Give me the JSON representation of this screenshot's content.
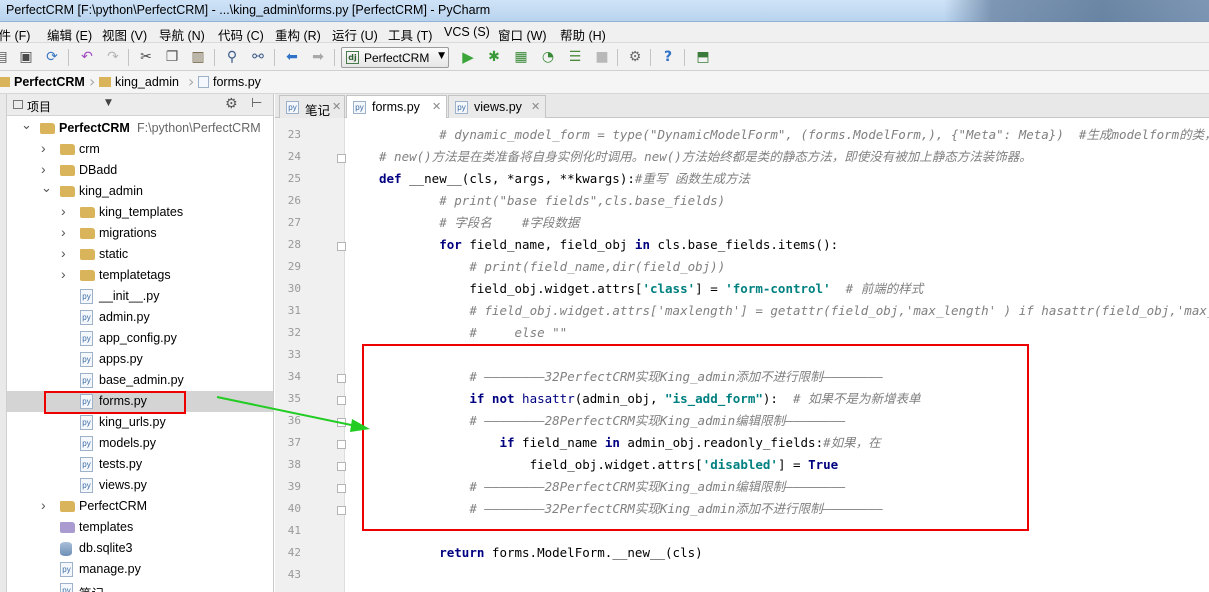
{
  "window": {
    "title": "PerfectCRM [F:\\python\\PerfectCRM] - ...\\king_admin\\forms.py [PerfectCRM] - PyCharm"
  },
  "menu": [
    "文件 (F)",
    "编辑 (E)",
    "视图 (V)",
    "导航 (N)",
    "代码 (C)",
    "重构 (R)",
    "运行 (U)",
    "工具 (T)",
    "VCS (S)",
    "窗口 (W)",
    "帮助 (H)"
  ],
  "toolbar": {
    "run_config": "PerfectCRM",
    "icons": [
      "save-icon",
      "sync-icon",
      "undo-icon",
      "redo-icon",
      "cut-icon",
      "copy-icon",
      "paste-icon",
      "find-icon",
      "replace-icon",
      "back-icon",
      "forward-icon",
      "run-icon",
      "debug-icon",
      "coverage-icon",
      "profile-icon",
      "concurrency-icon",
      "stop-icon",
      "settings-icon",
      "help-icon",
      "vcs-icon"
    ]
  },
  "breadcrumb": [
    "PerfectCRM",
    "king_admin",
    "forms.py"
  ],
  "project_panel": {
    "title": "项目",
    "tree": [
      {
        "label": "PerfectCRM",
        "sub": "F:\\python\\PerfectCRM",
        "type": "folder",
        "depth": 0,
        "expanded": true
      },
      {
        "label": "crm",
        "type": "folder",
        "depth": 1,
        "expanded": false
      },
      {
        "label": "DBadd",
        "type": "folder",
        "depth": 1,
        "expanded": false
      },
      {
        "label": "king_admin",
        "type": "folder",
        "depth": 1,
        "expanded": true
      },
      {
        "label": "king_templates",
        "type": "folder",
        "depth": 2,
        "expanded": false
      },
      {
        "label": "migrations",
        "type": "folder",
        "depth": 2,
        "expanded": false
      },
      {
        "label": "static",
        "type": "folder",
        "depth": 2,
        "expanded": false
      },
      {
        "label": "templatetags",
        "type": "folder",
        "depth": 2,
        "expanded": false
      },
      {
        "label": "__init__.py",
        "type": "py",
        "depth": 2
      },
      {
        "label": "admin.py",
        "type": "py",
        "depth": 2
      },
      {
        "label": "app_config.py",
        "type": "py",
        "depth": 2
      },
      {
        "label": "apps.py",
        "type": "py",
        "depth": 2
      },
      {
        "label": "base_admin.py",
        "type": "py",
        "depth": 2
      },
      {
        "label": "forms.py",
        "type": "py",
        "depth": 2,
        "selected": true
      },
      {
        "label": "king_urls.py",
        "type": "py",
        "depth": 2
      },
      {
        "label": "models.py",
        "type": "py",
        "depth": 2
      },
      {
        "label": "tests.py",
        "type": "py",
        "depth": 2
      },
      {
        "label": "views.py",
        "type": "py",
        "depth": 2
      },
      {
        "label": "PerfectCRM",
        "type": "folder",
        "depth": 1,
        "expanded": false
      },
      {
        "label": "templates",
        "type": "folder-purple",
        "depth": 1
      },
      {
        "label": "db.sqlite3",
        "type": "db",
        "depth": 1
      },
      {
        "label": "manage.py",
        "type": "py",
        "depth": 1
      },
      {
        "label": "笔记",
        "type": "py",
        "depth": 1
      }
    ]
  },
  "tabs": [
    {
      "label": "笔记",
      "active": false
    },
    {
      "label": "forms.py",
      "active": true
    },
    {
      "label": "views.py",
      "active": false
    }
  ],
  "editor": {
    "lines": [
      {
        "n": 23,
        "indent": 8,
        "tokens": [
          [
            "c-cm",
            "# dynamic_model_form = type(\"DynamicModelForm\", (forms.ModelForm,), {\"Meta\": Meta})  #生成modelform的类，"
          ]
        ]
      },
      {
        "n": 24,
        "indent": 0,
        "tokens": [
          [
            "c-cm",
            "# new()方法是在类准备将自身实例化时调用。new()方法始终都是类的静态方法，即使没有被加上静态方法装饰器。"
          ]
        ]
      },
      {
        "n": 25,
        "indent": 0,
        "tokens": [
          [
            "c-kw",
            "def "
          ],
          [
            "c-fn",
            "__new__"
          ],
          [
            "c-pl",
            "(cls, *args, **kwargs):"
          ],
          [
            "c-cm",
            "#重写 函数生成方法"
          ]
        ]
      },
      {
        "n": 26,
        "indent": 8,
        "tokens": [
          [
            "c-cm",
            "# print(\"base fields\",cls.base_fields)"
          ]
        ]
      },
      {
        "n": 27,
        "indent": 8,
        "tokens": [
          [
            "c-cm",
            "# 字段名    #字段数据"
          ]
        ]
      },
      {
        "n": 28,
        "indent": 8,
        "tokens": [
          [
            "c-kw",
            "for "
          ],
          [
            "c-pl",
            "field_name, field_obj "
          ],
          [
            "c-kw",
            "in "
          ],
          [
            "c-pl",
            "cls.base_fields.items():"
          ]
        ]
      },
      {
        "n": 29,
        "indent": 12,
        "tokens": [
          [
            "c-cm",
            "# print(field_name,dir(field_obj))"
          ]
        ]
      },
      {
        "n": 30,
        "indent": 12,
        "tokens": [
          [
            "c-pl",
            "field_obj.widget.attrs["
          ],
          [
            "c-st",
            "'class'"
          ],
          [
            "c-pl",
            "] = "
          ],
          [
            "c-st",
            "'form-control'"
          ],
          [
            "c-pl",
            "  "
          ],
          [
            "c-cm",
            "# 前端的样式"
          ]
        ]
      },
      {
        "n": 31,
        "indent": 12,
        "tokens": [
          [
            "c-cm",
            "# field_obj.widget.attrs['maxlength'] = getattr(field_obj,'max_length' ) if hasattr(field_obj,'max_length') \\"
          ]
        ]
      },
      {
        "n": 32,
        "indent": 12,
        "tokens": [
          [
            "c-cm",
            "#     else \"\""
          ]
        ]
      },
      {
        "n": 33,
        "indent": 0,
        "tokens": []
      },
      {
        "n": 34,
        "indent": 12,
        "tokens": [
          [
            "c-cm",
            "# ————————32PerfectCRM实现King_admin添加不进行限制————————"
          ]
        ]
      },
      {
        "n": 35,
        "indent": 12,
        "tokens": [
          [
            "c-kw",
            "if not "
          ],
          [
            "c-bi",
            "hasattr"
          ],
          [
            "c-pl",
            "(admin_obj, "
          ],
          [
            "c-st",
            "\"is_add_form\""
          ],
          [
            "c-pl",
            "):  "
          ],
          [
            "c-cm",
            "# 如果不是为新增表单"
          ]
        ]
      },
      {
        "n": 36,
        "indent": 12,
        "tokens": [
          [
            "c-cm",
            "# ————————28PerfectCRM实现King_admin编辑限制————————"
          ]
        ]
      },
      {
        "n": 37,
        "indent": 16,
        "tokens": [
          [
            "c-kw",
            "if "
          ],
          [
            "c-pl",
            "field_name "
          ],
          [
            "c-kw",
            "in "
          ],
          [
            "c-pl",
            "admin_obj.readonly_fields:"
          ],
          [
            "c-cm",
            "#如果，在"
          ]
        ]
      },
      {
        "n": 38,
        "indent": 20,
        "tokens": [
          [
            "c-pl",
            "field_obj.widget.attrs["
          ],
          [
            "c-st",
            "'disabled'"
          ],
          [
            "c-pl",
            "] = "
          ],
          [
            "c-kw",
            "True"
          ]
        ]
      },
      {
        "n": 39,
        "indent": 12,
        "tokens": [
          [
            "c-cm",
            "# ————————28PerfectCRM实现King_admin编辑限制————————"
          ]
        ]
      },
      {
        "n": 40,
        "indent": 12,
        "tokens": [
          [
            "c-cm",
            "# ————————32PerfectCRM实现King_admin添加不进行限制————————"
          ]
        ]
      },
      {
        "n": 41,
        "indent": 0,
        "tokens": []
      },
      {
        "n": 42,
        "indent": 8,
        "tokens": [
          [
            "c-kw",
            "return "
          ],
          [
            "c-pl",
            "forms.ModelForm."
          ],
          [
            "c-fn",
            "__new__"
          ],
          [
            "c-pl",
            "(cls)"
          ]
        ]
      },
      {
        "n": 43,
        "indent": 0,
        "tokens": []
      }
    ]
  },
  "colors": {
    "highlight_box": "#e00000",
    "arrow": "#22cc22",
    "keyword": "#000080",
    "string": "#008080",
    "comment": "#808080"
  }
}
